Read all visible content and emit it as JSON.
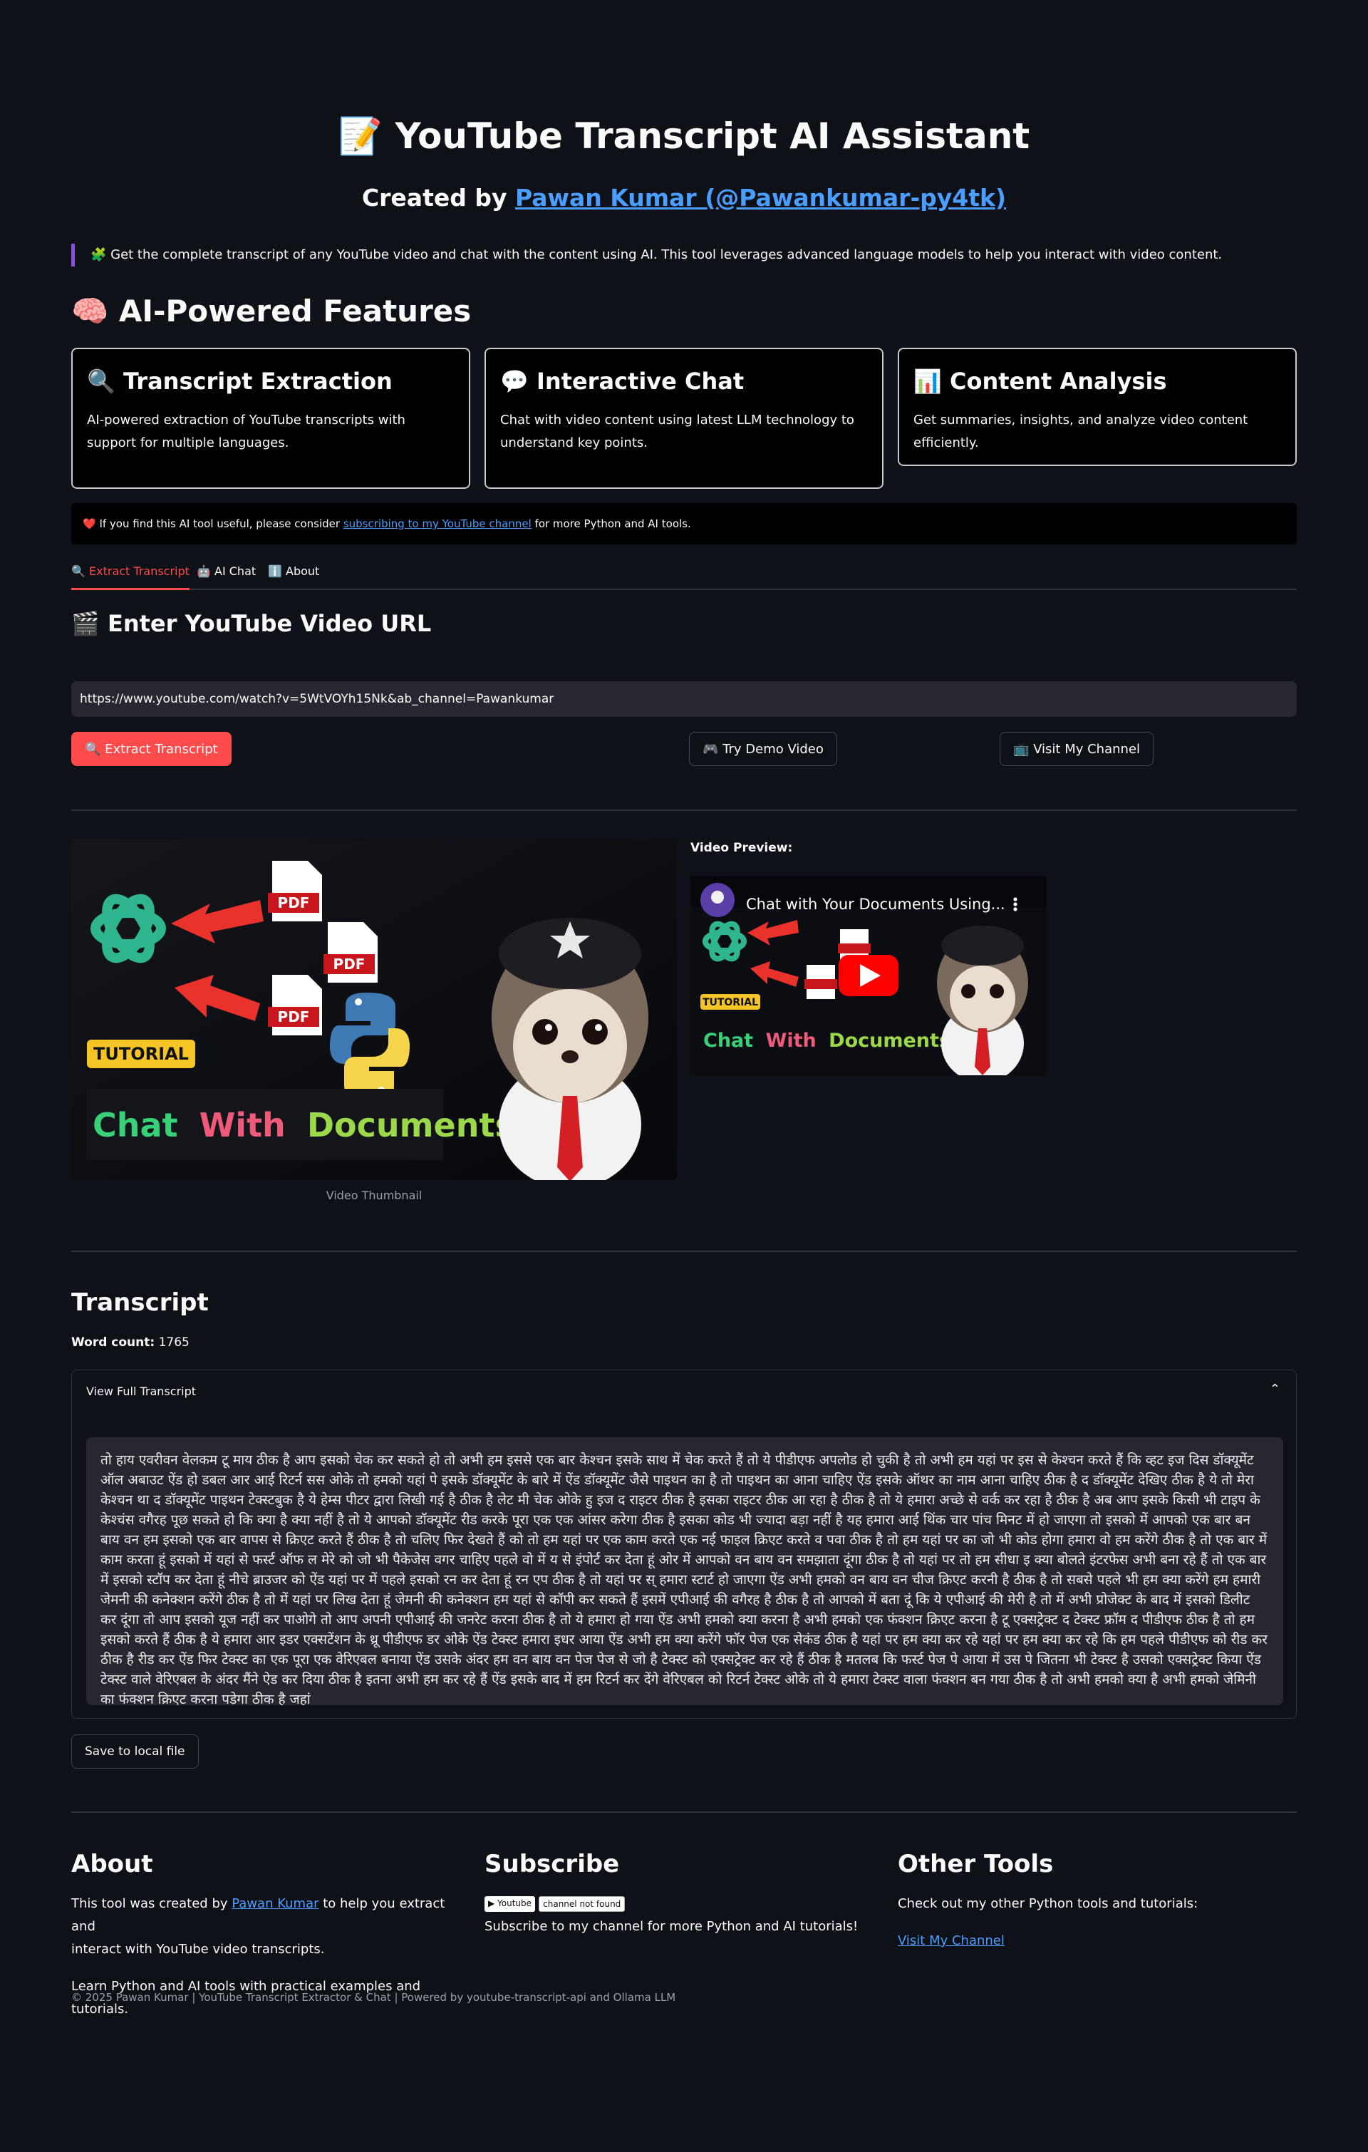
{
  "header": {
    "title": "📝 YouTube Transcript AI Assistant",
    "created_by_prefix": "Created by ",
    "created_by_link": "Pawan Kumar (@Pawankumar-py4tk)",
    "intro": "🧩 Get the complete transcript of any YouTube video and chat with the content using AI. This tool leverages advanced language models to help you interact with video content."
  },
  "features": {
    "heading": "🧠 AI-Powered Features",
    "cards": [
      {
        "title": "🔍 Transcript Extraction",
        "text": "AI-powered extraction of YouTube transcripts with support for multiple languages."
      },
      {
        "title": "💬 Interactive Chat",
        "text": "Chat with video content using latest LLM technology to understand key points."
      },
      {
        "title": "📊 Content Analysis",
        "text": "Get summaries, insights, and analyze video content efficiently."
      }
    ]
  },
  "support": {
    "prefix": "❤️ If you find this AI tool useful, please consider ",
    "link": "subscribing to my YouTube channel",
    "suffix": " for more Python and AI tools."
  },
  "tabs": [
    "🔍 Extract Transcript",
    "🤖 AI Chat",
    "ℹ️ About"
  ],
  "url_section": {
    "heading": "🎬 Enter YouTube Video URL",
    "input_value": "https://www.youtube.com/watch?v=5WtVOYh15Nk&ab_channel=Pawankumar",
    "extract_button": "🔍 Extract Transcript",
    "demo_button": "🎮 Try Demo Video",
    "channel_button": "📺 Visit My Channel"
  },
  "thumbnail": {
    "pdf_label": "PDF",
    "tutorial": "TUTORIAL",
    "title_chat": "Chat",
    "title_with": "With",
    "title_documents": "Documents",
    "caption": "Video Thumbnail"
  },
  "preview": {
    "label": "Video Preview:",
    "video_title": "Chat with Your Documents Using..."
  },
  "transcript": {
    "heading": "Transcript",
    "word_count_label": "Word count:",
    "word_count": "1765",
    "expander_label": "View Full Transcript",
    "text": "तो हाय एवरीवन वेलकम टू माय ठीक है आप इसको चेक कर सकते हो तो अभी हम इससे एक बार केश्चन इसके साथ में चेक करते हैं तो ये पीडीएफ अपलोड हो चुकी है तो अभी हम यहां पर इस से केश्चन करते हैं कि व्हट इज दिस डॉक्यूमेंट ऑल अबाउट ऐंड हो डबल आर आई रिटर्न सस ओके तो हमको यहां पे इसके डॉक्यूमेंट के बारे में ऐंड डॉक्यूमेंट जैसे पाइथन का है तो पाइथन का आना चाहिए ऐंड इसके ऑथर का नाम आना चाहिए ठीक है द डॉक्यूमेंट देखिए ठीक है ये तो मेरा केश्चन था द डॉक्यूमेंट पाइथन टेक्स्टबुक है ये हेम्स पीटर द्वारा लिखी गई है ठीक है लेट मी चेक ओके हु इज द राइटर ठीक है इसका राइटर ठीक आ रहा है ठीक है तो ये हमारा अच्छे से वर्क कर रहा है ठीक है अब आप इसके किसी भी टाइप के केश्चंस वगैरह पूछ सकते हो कि क्या है क्या नहीं है तो ये आपको डॉक्यूमेंट रीड करके पूरा एक एक आंसर करेगा ठीक है इसका कोड भी ज्यादा बड़ा नहीं है यह हमारा आई थिंक चार पांच मिनट में हो जाएगा तो इसको में आपको एक बार बन बाय वन हम इसको एक बार वापस से क्रिएट करते हैं ठीक है तो चलिए फिर देखते हैं को तो हम यहां पर एक काम करते एक नई फाइल क्रिएट करते व पवा ठीक है तो हम यहां पर का जो भी कोड होगा हमारा वो हम करेंगे ठीक है तो एक बार में काम करता हूं इसको में यहां से फर्स्ट ऑफ ल मेरे को जो भी पैकेजेस वगर चाहिए पहले वो में य से इंपोर्ट कर देता हूं ओर में आपको वन बाय वन समझाता दूंगा ठीक है तो यहां पर तो हम सीधा इ क्या बोलते इंटरफेस अभी बना रहे हैं तो एक बार में इसको स्टॉप कर देता हूं नीचे ब्राउजर को ऐंड यहां पर में पहले इसको रन कर देता हूं रन एप ठीक है तो यहां पर स् हमारा स्टार्ट हो जाएगा ऐंड अभी हमको वन बाय वन चीज क्रिएट करनी है ठीक है तो सबसे पहले भी हम क्या करेंगे हम हमारी जेमनी की कनेक्शन करेंगे ठीक है तो में यहां पर लिख देता हूं जेमनी की कनेक्शन हम यहां से कॉपी कर सकते हैं इसमें एपीआई की वगैरह है ठीक है तो आपको में बता दूं कि ये एपीआई की मेरी है तो में अभी प्रोजेक्ट के बाद में इसको डिलीट कर दूंगा तो आप इसको यूज नहीं कर पाओगे तो आप अपनी एपीआई की जनरेट करना ठीक है तो ये हमारा हो गया ऐंड अभी हमको क्या करना है अभी हमको एक फंक्शन क्रिएट करना है टू एक्सट्रेक्ट द टेक्स्ट फ्रॉम द पीडीएफ ठीक है तो हम इसको करते हैं ठीक है ये हमारा आर इडर एक्सटेंशन के थ्रू पीडीएफ डर ओके ऐंड टेक्स्ट हमारा इधर आया ऐंड अभी हम क्या करेंगे फॉर पेज एक सेकंड ठीक है यहां पर हम क्या कर रहे यहां पर हम क्या कर रहे कि हम पहले पीडीएफ को रीड कर ठीक है रीड कर ऐंड फिर टेक्स्ट का एक पूरा एक वेरिएबल बनाया ऐंड उसके अंदर हम वन बाय वन पेज पेज से जो है टेक्स्ट को एक्सट्रेक्ट कर रहे हैं ठीक है मतलब कि फर्स्ट पेज पे आया में उस पे जितना भी टेक्स्ट है उसको एक्सट्रेक्ट किया ऐंड टेक्स्ट वाले वेरिएबल के अंदर मैंने ऐड कर दिया ठीक है इतना अभी हम कर रहे हैं ऐंड इसके बाद में हम रिटर्न कर देंगे वेरिएबल को रिटर्न टेक्स्ट ओके तो ये हमारा टेक्स्ट वाला फंक्शन बन गया ठीक है तो अभी हमको क्या है अभी हमको जेमिनी का फंक्शन क्रिएट करना पड़ेगा ठीक है जहां"
  },
  "save_button": "Save to local file",
  "footer": {
    "about": {
      "heading": "About",
      "line1_prefix": "This tool was created by ",
      "line1_link": "Pawan Kumar",
      "line1_suffix": " to help you extract and",
      "line2": "interact with YouTube video transcripts.",
      "line3": "Learn Python and AI tools with practical examples and tutorials."
    },
    "subscribe": {
      "heading": "Subscribe",
      "badge_left": "▶ Youtube",
      "badge_right": "channel not found",
      "text": "Subscribe to my channel for more Python and AI tutorials!"
    },
    "tools": {
      "heading": "Other Tools",
      "text": "Check out my other Python tools and tutorials:",
      "link": "Visit My Channel"
    },
    "copyright": "© 2025 Pawan Kumar | YouTube Transcript Extractor & Chat | Powered by youtube-transcript-api and Ollama LLM"
  },
  "colors": {
    "background": "#0e1117",
    "accent": "#ff4b4b",
    "link": "#4a9eff",
    "input_bg": "#262730"
  }
}
